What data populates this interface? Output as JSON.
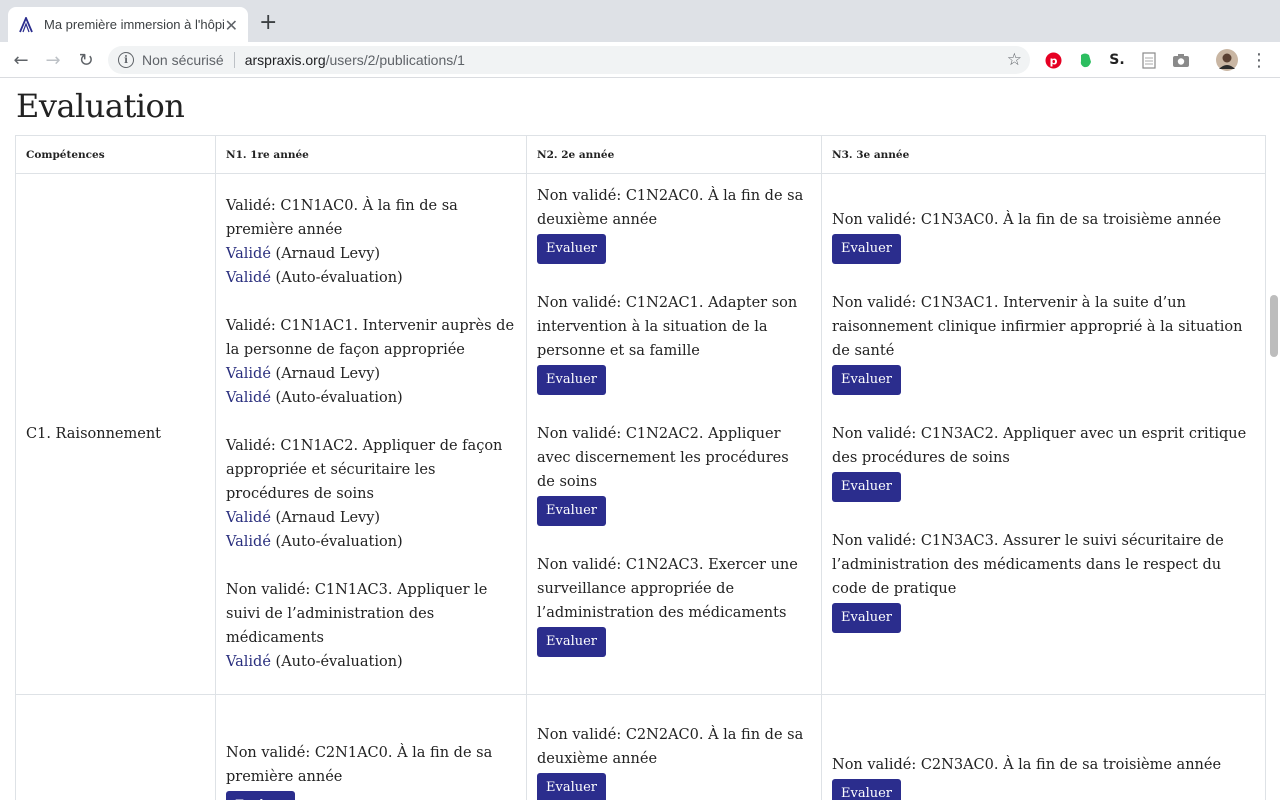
{
  "browser": {
    "tab_title": "Ma première immersion à l'hôpital",
    "close_glyph": "✕",
    "new_tab_glyph": "+",
    "security_label": "Non sécurisé",
    "url_host": "arspraxis.org",
    "url_path": "/users/2/publications/1",
    "back_glyph": "←",
    "forward_glyph": "→",
    "reload_glyph": "↻",
    "star_glyph": "☆",
    "menu_glyph": "⋮",
    "info_glyph": "i",
    "extensions": [
      "pinterest-icon",
      "evernote-icon",
      "s-extension-icon",
      "document-icon",
      "camera-icon",
      "profile-avatar"
    ],
    "ext_s_glyph": "S."
  },
  "page": {
    "title": "Evaluation",
    "columns": [
      "Compétences",
      "N1. 1re année",
      "N2. 2e année",
      "N3. 3e année"
    ],
    "button_label": "Evaluer",
    "rows": [
      {
        "competence": "C1. Raisonnement",
        "n1": [
          {
            "text": "Validé: C1N1AC0. À la fin de sa première année",
            "validations": [
              {
                "link": "Validé",
                "by": " (Arnaud Levy)"
              },
              {
                "link": "Validé",
                "by": " (Auto-évaluation)"
              }
            ]
          },
          {
            "text": "Validé: C1N1AC1. Intervenir auprès de la personne de façon appropriée",
            "validations": [
              {
                "link": "Validé",
                "by": " (Arnaud Levy)"
              },
              {
                "link": "Validé",
                "by": " (Auto-évaluation)"
              }
            ]
          },
          {
            "text": "Validé: C1N1AC2. Appliquer de façon appropriée et sécuritaire les procédures de soins",
            "validations": [
              {
                "link": "Validé",
                "by": " (Arnaud Levy)"
              },
              {
                "link": "Validé",
                "by": " (Auto-évaluation)"
              }
            ]
          },
          {
            "text": "Non validé: C1N1AC3. Appliquer le suivi de l’administration des médicaments",
            "validations": [
              {
                "link": "Validé",
                "by": " (Auto-évaluation)"
              }
            ]
          }
        ],
        "n2": [
          "Non validé: C1N2AC0. À la fin de sa deuxième année",
          "Non validé: C1N2AC1. Adapter son intervention à la situation de la personne et sa famille",
          "Non validé: C1N2AC2. Appliquer avec discernement les procédures de soins",
          "Non validé: C1N2AC3. Exercer une surveillance appropriée de l’administration des médicaments"
        ],
        "n3": [
          "Non validé: C1N3AC0. À la fin de sa troisième année",
          "Non validé: C1N3AC1. Intervenir à la suite d’un raisonnement clinique infirmier approprié à la situation de santé",
          "Non validé: C1N3AC2. Appliquer avec un esprit critique des procédures de soins",
          "Non validé: C1N3AC3. Assurer le suivi sécuritaire de l’administration des médicaments dans le respect du code de pratique"
        ]
      },
      {
        "competence": "",
        "n1": [
          "Non validé: C2N1AC0. À la fin de sa première année"
        ],
        "n2": [
          "Non validé: C2N2AC0. À la fin de sa deuxième année"
        ],
        "n3": [
          "Non validé: C2N3AC0. À la fin de sa troisième année"
        ]
      }
    ]
  },
  "colors": {
    "button_bg": "#2b2d8d",
    "link": "#2a2f7e",
    "tabstrip": "#dee1e6"
  }
}
